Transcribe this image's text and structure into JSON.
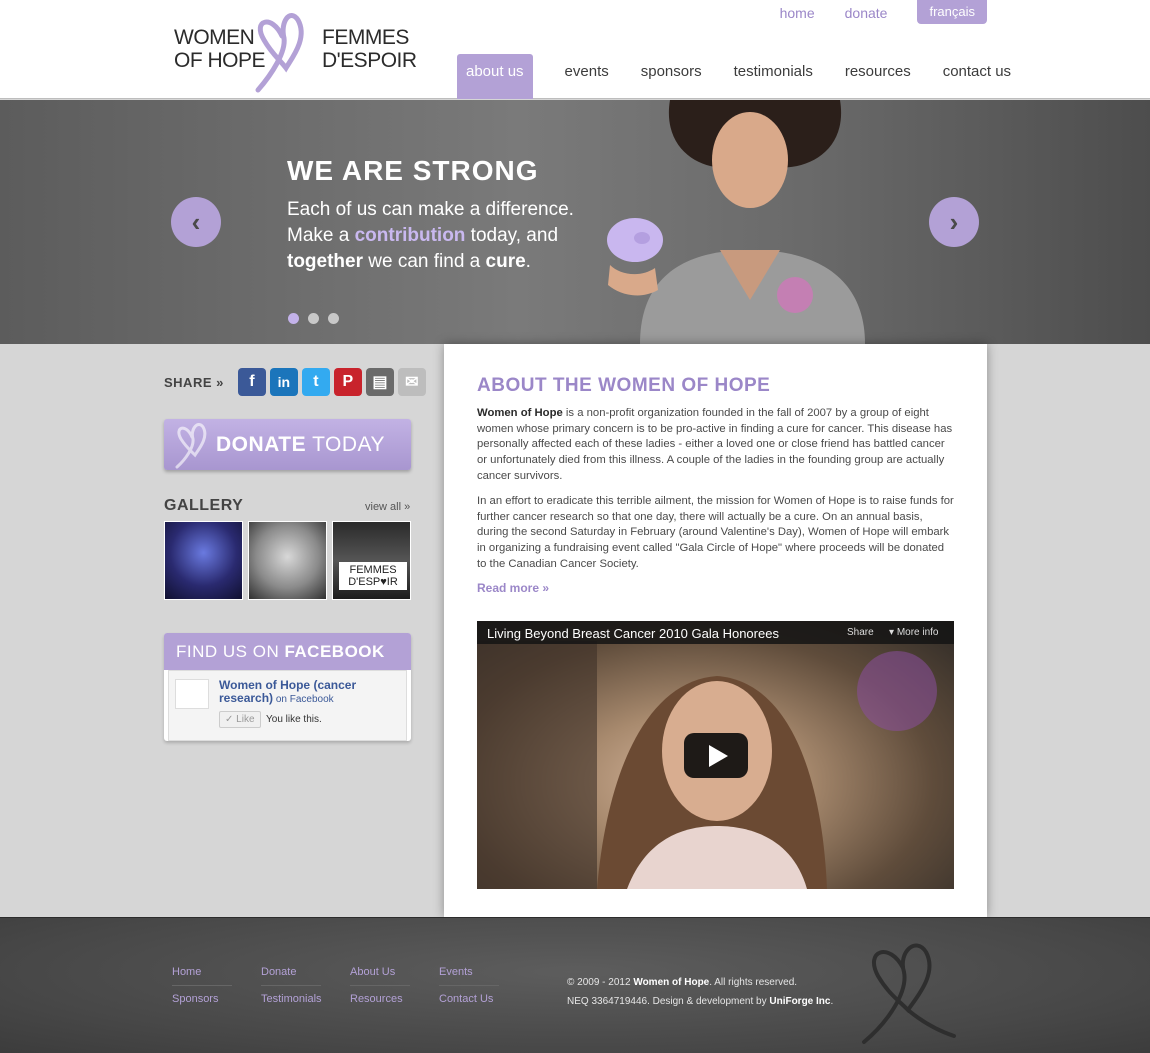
{
  "brand": {
    "logo_en_line1": "WOMEN",
    "logo_en_line2": "OF HOPE",
    "logo_fr_line1": "FEMMES",
    "logo_fr_line2": "D'ESPOIR",
    "accent": "#b3a1d6",
    "accent_text": "#9b87c8"
  },
  "top_links": {
    "home": "home",
    "donate": "donate",
    "language": "français"
  },
  "nav": [
    {
      "label": "about us",
      "active": true
    },
    {
      "label": "events"
    },
    {
      "label": "sponsors"
    },
    {
      "label": "testimonials"
    },
    {
      "label": "resources"
    },
    {
      "label": "contact us"
    }
  ],
  "hero": {
    "title": "WE ARE STRONG",
    "line1": "Each of us can make a difference.",
    "line2_pre": "Make a ",
    "line2_hl": "contribution",
    "line2_post": " today, and",
    "line3_b1": "together",
    "line3_mid": " we can find a ",
    "line3_b2": "cure",
    "line3_end": ".",
    "prev_icon": "chevron-left-icon",
    "next_icon": "chevron-right-icon",
    "slides": 3,
    "active_slide": 1
  },
  "sidebar": {
    "share_label": "SHARE",
    "share_suffix": "»",
    "share_icons": [
      {
        "name": "facebook-icon",
        "glyph": "f",
        "color": "#3b5998"
      },
      {
        "name": "linkedin-icon",
        "glyph": "in",
        "color": "#1b75bb"
      },
      {
        "name": "twitter-icon",
        "glyph": "t",
        "color": "#33aaf0"
      },
      {
        "name": "pinterest-icon",
        "glyph": "P",
        "color": "#c8232c"
      },
      {
        "name": "print-icon",
        "glyph": "▤",
        "color": "#6a6a6a"
      },
      {
        "name": "email-icon",
        "glyph": "✉",
        "color": "#bdbdbd"
      }
    ],
    "donate_bold": "DONATE",
    "donate_rest": " TODAY",
    "gallery_title": "GALLERY",
    "gallery_view_all": "view all »",
    "gallery_thumb3_text": "FEMMES D'ESP♥IR",
    "facebook_head_pre": "FIND US ON ",
    "facebook_head_bold": "FACEBOOK",
    "facebook_page_name": "Women of Hope (cancer research)",
    "facebook_on": " on Facebook",
    "facebook_like": "✓ Like",
    "facebook_you_like": "You like this."
  },
  "main": {
    "title": "ABOUT THE WOMEN OF HOPE",
    "p1_bold": "Women of Hope",
    "p1_rest": " is a non-profit organization founded in the fall of 2007 by a group of eight women whose primary concern is to be pro-active in finding a cure for cancer. This disease has personally affected each of these ladies - either a loved one or close friend has battled cancer or unfortunately died from this illness. A couple of the ladies in the founding group are actually cancer survivors.",
    "p2": "In an effort to eradicate this terrible ailment, the mission for Women of Hope is to raise funds for further cancer research so that one day, there will actually be a cure. On an annual basis, during the second Saturday in February (around Valentine's Day), Women of Hope will embark in organizing a fundraising event called \"Gala Circle of Hope\" where proceeds will be donated to the Canadian Cancer Society.",
    "read_more": "Read more »",
    "video": {
      "title": "Living Beyond Breast Cancer 2010 Gala Honorees",
      "share": "Share",
      "more_info": "More info"
    }
  },
  "footer": {
    "col1": [
      "Home",
      "Sponsors"
    ],
    "col2": [
      "Donate",
      "Testimonials"
    ],
    "col3": [
      "About Us",
      "Resources"
    ],
    "col4": [
      "Events",
      "Contact Us"
    ],
    "copy_pre": "© 2009 - 2012 ",
    "copy_bold": "Women of Hope",
    "copy_post": ". All rights reserved.",
    "neq_pre": "NEQ 3364719446. Design & development by ",
    "neq_bold": "UniForge Inc",
    "neq_post": "."
  }
}
